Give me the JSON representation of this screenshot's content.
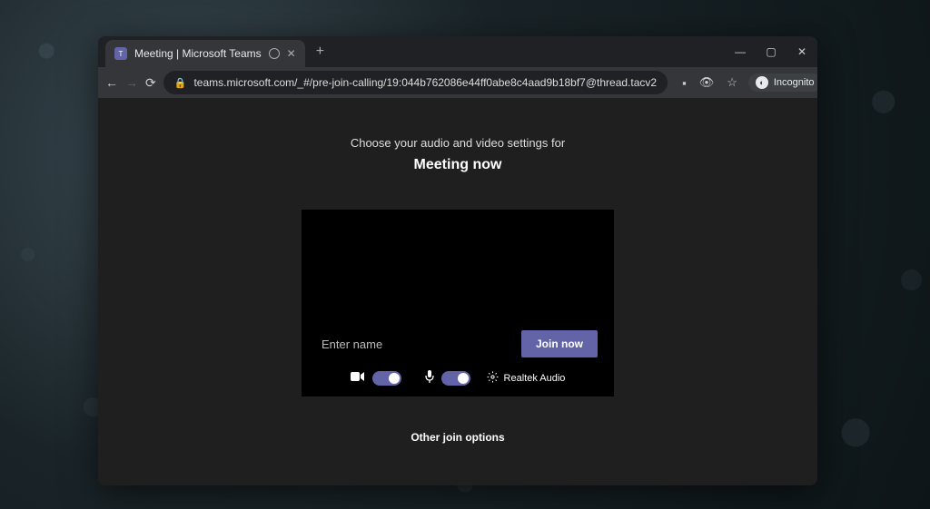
{
  "browser": {
    "tab": {
      "title": "Meeting | Microsoft Teams"
    },
    "url": "teams.microsoft.com/_#/pre-join-calling/19:044b762086e44ff0abe8c4aad9b18bf7@thread.tacv2",
    "incognito_label": "Incognito"
  },
  "page": {
    "subtitle": "Choose your audio and video settings for",
    "title": "Meeting now",
    "name_placeholder": "Enter name",
    "join_label": "Join now",
    "audio_device": "Realtek Audio",
    "other_options": "Other join options"
  }
}
